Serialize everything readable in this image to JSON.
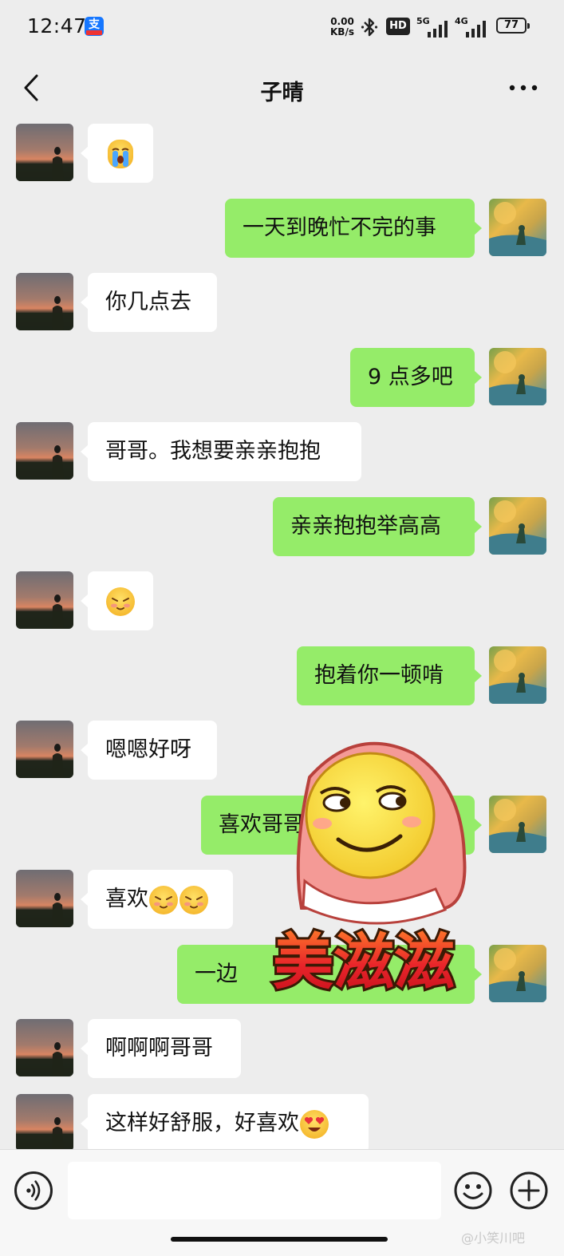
{
  "status_bar": {
    "time": "12:47",
    "app_badge": "支",
    "net_speed_value": "0.00",
    "net_speed_unit": "KB/s",
    "hd_label": "HD",
    "signal1_label": "5G",
    "signal2_label": "4G",
    "battery": "77"
  },
  "header": {
    "title": "子晴"
  },
  "messages": [
    {
      "side": "in",
      "text": "",
      "emoji": [
        "crying-face"
      ]
    },
    {
      "side": "out",
      "text": "一天到晚忙不完的事"
    },
    {
      "side": "in",
      "text": "你几点去"
    },
    {
      "side": "out",
      "text": "9 点多吧"
    },
    {
      "side": "in",
      "text": "哥哥。我想要亲亲抱抱"
    },
    {
      "side": "out",
      "text": "亲亲抱抱举高高"
    },
    {
      "side": "in",
      "text": "",
      "emoji": [
        "shy-face"
      ]
    },
    {
      "side": "out",
      "text": "抱着你一顿啃"
    },
    {
      "side": "in",
      "text": "嗯嗯好呀"
    },
    {
      "side": "out",
      "text": "喜欢哥哥"
    },
    {
      "side": "in",
      "text": "喜欢",
      "emoji": [
        "shy-face",
        "shy-face"
      ]
    },
    {
      "side": "out",
      "text": "一边"
    },
    {
      "side": "in",
      "text": "啊啊啊哥哥"
    },
    {
      "side": "in",
      "text": "这样好舒服，好喜欢",
      "emoji": [
        "heart-eyes-face"
      ]
    }
  ],
  "sticker": {
    "text": "美滋滋",
    "icon": "smirking-face-blanket-sticker"
  },
  "input_bar": {
    "message_value": "",
    "message_placeholder": ""
  },
  "watermark": "@小笑川吧",
  "colors": {
    "background": "#ededed",
    "outgoing_bubble": "#95ec69",
    "incoming_bubble": "#ffffff"
  }
}
